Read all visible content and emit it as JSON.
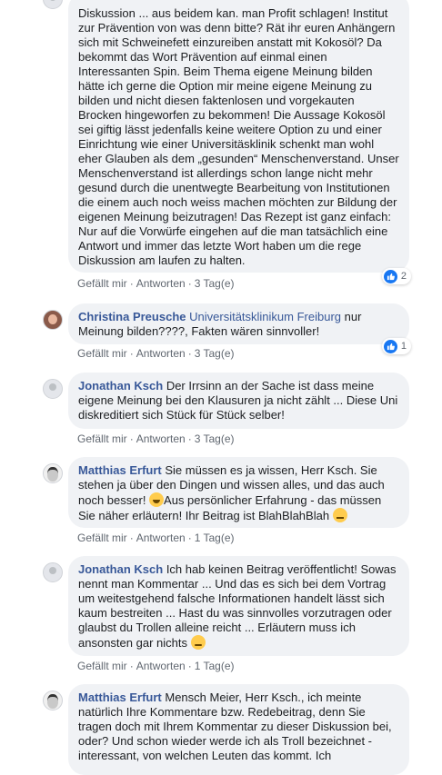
{
  "labels": {
    "like": "Gefällt mir",
    "reply": "Antworten",
    "dot": "·"
  },
  "comments": [
    {
      "author": "",
      "text": "Diskussion ... aus beidem kan. man Profit schlagen! Institut zur Prävention von was denn bitte? Rät ihr euren Anhängern sich mit Schweinefett einzureiben anstatt mit Kokosöl? Da bekommt das Wort Prävention auf einmal einen Interessanten Spin. Beim Thema eigene Meinung bilden hätte ich gerne die Option mir meine eigene Meinung zu bilden und nicht diesen faktenlosen und vorgekauten Brocken hingeworfen zu bekommen! Die Aussage Kokosöl sei giftig lässt jedenfalls keine weitere Option zu und einer Einrichtung wie einer Universitäsklinik schenkt man wohl eher Glauben als dem „gesunden“ Menschenverstand. Unser Menschenverstand ist allerdings schon lange nicht mehr gesund durch die unentwegte Bearbeitung von Institutionen die einem auch noch weiss machen möchten zur Bildung der eigenen Meinung beizutragen! Das Rezept ist ganz einfach: Nur auf die Vorwürfe eingehen auf die man tatsächlich eine Antwort und immer das letzte Wort haben um die rege Diskussion am laufen zu halten.",
      "time": "3 Tag(e)",
      "likes": "2"
    },
    {
      "author": "Christina Preusche",
      "mention": "Universitätsklinikum Freiburg",
      "text": " nur Meinung bilden????, Fakten wären sinnvoller!",
      "time": "3 Tag(e)",
      "likes": "1"
    },
    {
      "author": "Jonathan Ksch",
      "text": "Der Irrsinn an der Sache ist dass meine eigene Meinung bei den Klausuren ja nicht zählt ... Diese Uni diskreditiert sich Stück für Stück selber!",
      "time": "3 Tag(e)"
    },
    {
      "author": "Matthias Erfurt",
      "text_a": "Sie müssen es ja wissen, Herr Ksch. Sie stehen ja über den Dingen und wissen alles, und das auch noch besser! ",
      "text_b": "Aus persönlicher Erfahrung - das müssen Sie näher erläutern! Ihr Beitrag ist BlahBlahBlah ",
      "emoji_a": "grinning-squinting-face",
      "emoji_b": "sleepy-face",
      "time": "1 Tag(e)"
    },
    {
      "author": "Jonathan Ksch",
      "text": "Ich hab keinen Beitrag veröffentlicht! Sowas nennt man Kommentar ... Und das es sich bei dem Vortrag um weitestgehend falsche Informationen handelt lässt sich kaum bestreiten ... Hast du was sinnvolles vorzutragen oder glaubst du Trollen alleine reicht ... Erläutern muss ich ansonsten gar nichts ",
      "emoji": "winking-face",
      "time": "1 Tag(e)"
    },
    {
      "author": "Matthias Erfurt",
      "text": "Mensch Meier, Herr Ksch., ich meinte natürlich Ihre Kommentare bzw. Redebeitrag, denn Sie tragen doch mit Ihrem Kommentar zu dieser Diskussion bei, oder? Und schon wieder werde ich als Troll bezeichnet - interessant, von welchen Leuten das kommt. Ich"
    }
  ]
}
